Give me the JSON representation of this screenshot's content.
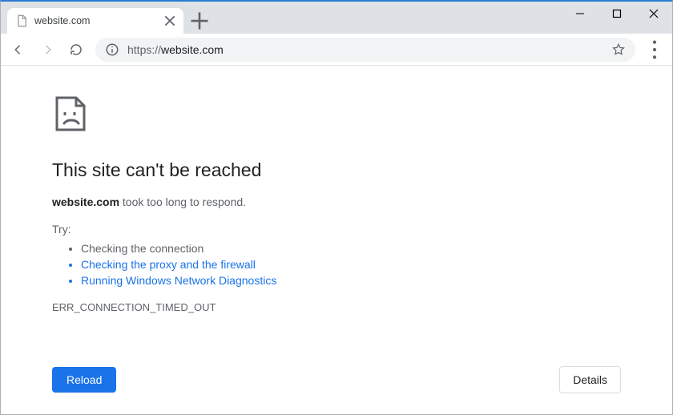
{
  "tab": {
    "title": "website.com"
  },
  "omnibox": {
    "scheme": "https://",
    "host": "website.com"
  },
  "error": {
    "title": "This site can't be reached",
    "host": "website.com",
    "msg_suffix": " took too long to respond.",
    "try_label": "Try:",
    "suggestions": [
      {
        "text": "Checking the connection",
        "link": false
      },
      {
        "text": "Checking the proxy and the firewall",
        "link": true
      },
      {
        "text": "Running Windows Network Diagnostics",
        "link": true
      }
    ],
    "code": "ERR_CONNECTION_TIMED_OUT"
  },
  "buttons": {
    "reload": "Reload",
    "details": "Details"
  }
}
